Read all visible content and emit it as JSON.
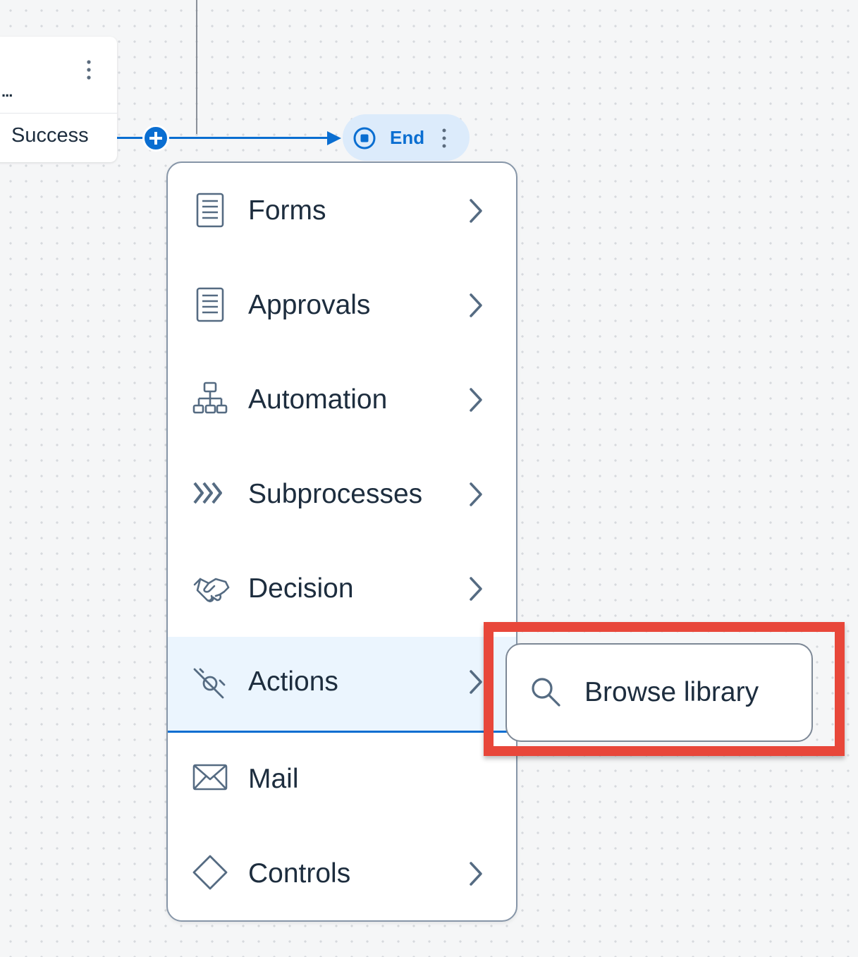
{
  "canvas": {
    "node": {
      "ellipsis": "...",
      "status_label": "Success",
      "more_icon": "more-vertical-icon"
    },
    "add_button_icon": "plus-circle-icon",
    "end_node": {
      "label": "End",
      "icon": "stop-circle-icon",
      "more_icon": "more-vertical-icon"
    }
  },
  "menu": {
    "items": [
      {
        "label": "Forms",
        "icon": "form-icon",
        "has_submenu": true
      },
      {
        "label": "Approvals",
        "icon": "approval-form-icon",
        "has_submenu": true
      },
      {
        "label": "Automation",
        "icon": "hierarchy-icon",
        "has_submenu": true
      },
      {
        "label": "Subprocesses",
        "icon": "chevrons-right-icon",
        "has_submenu": true
      },
      {
        "label": "Decision",
        "icon": "handshake-icon",
        "has_submenu": true
      },
      {
        "label": "Actions",
        "icon": "action-icon",
        "has_submenu": true,
        "selected": true
      },
      {
        "label": "Mail",
        "icon": "mail-icon",
        "has_submenu": false
      },
      {
        "label": "Controls",
        "icon": "diamond-icon",
        "has_submenu": true
      }
    ]
  },
  "submenu": {
    "label": "Browse library",
    "icon": "search-icon"
  },
  "colors": {
    "accent": "#0a6ed1",
    "highlight": "#e8473a",
    "selected_bg": "#ebf5fe"
  }
}
